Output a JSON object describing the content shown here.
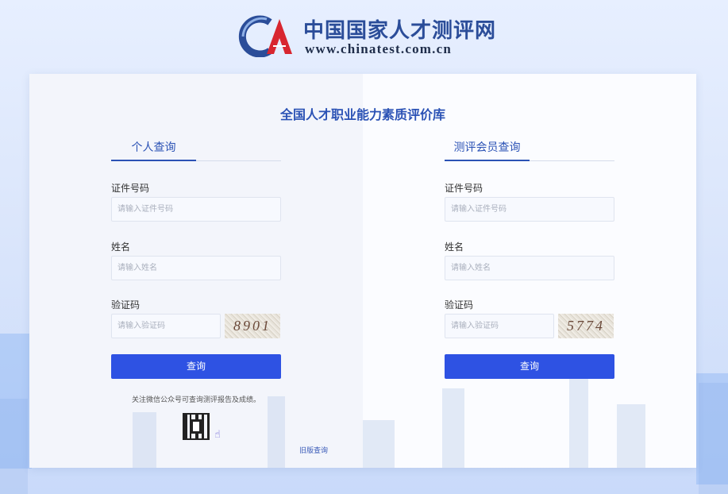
{
  "header": {
    "site_title": "中国国家人才测评网",
    "site_url": "www.chinatest.com.cn"
  },
  "card": {
    "title": "全国人才职业能力素质评价库"
  },
  "personal": {
    "tab_label": "个人查询",
    "id_label": "证件号码",
    "id_placeholder": "请输入证件号码",
    "name_label": "姓名",
    "name_placeholder": "请输入姓名",
    "captcha_label": "验证码",
    "captcha_placeholder": "请输入验证码",
    "captcha_text": "8901",
    "submit_label": "查询",
    "wechat_note": "关注微信公众号可查询测评报告及成绩。"
  },
  "member": {
    "tab_label": "测评会员查询",
    "id_label": "证件号码",
    "id_placeholder": "请输入证件号码",
    "name_label": "姓名",
    "name_placeholder": "请输入姓名",
    "captcha_label": "验证码",
    "captcha_placeholder": "请输入验证码",
    "captcha_text": "5774",
    "submit_label": "查询"
  },
  "footer": {
    "history_link": "旧版查询"
  },
  "colors": {
    "accent": "#2e52e3",
    "title_blue": "#2b52b5",
    "logo_blue": "#2b4d99",
    "logo_red": "#d8262f"
  },
  "icons": {
    "logo": "ca-logo-icon",
    "qr": "qr-code-icon",
    "pointer": "hand-pointer-icon"
  }
}
